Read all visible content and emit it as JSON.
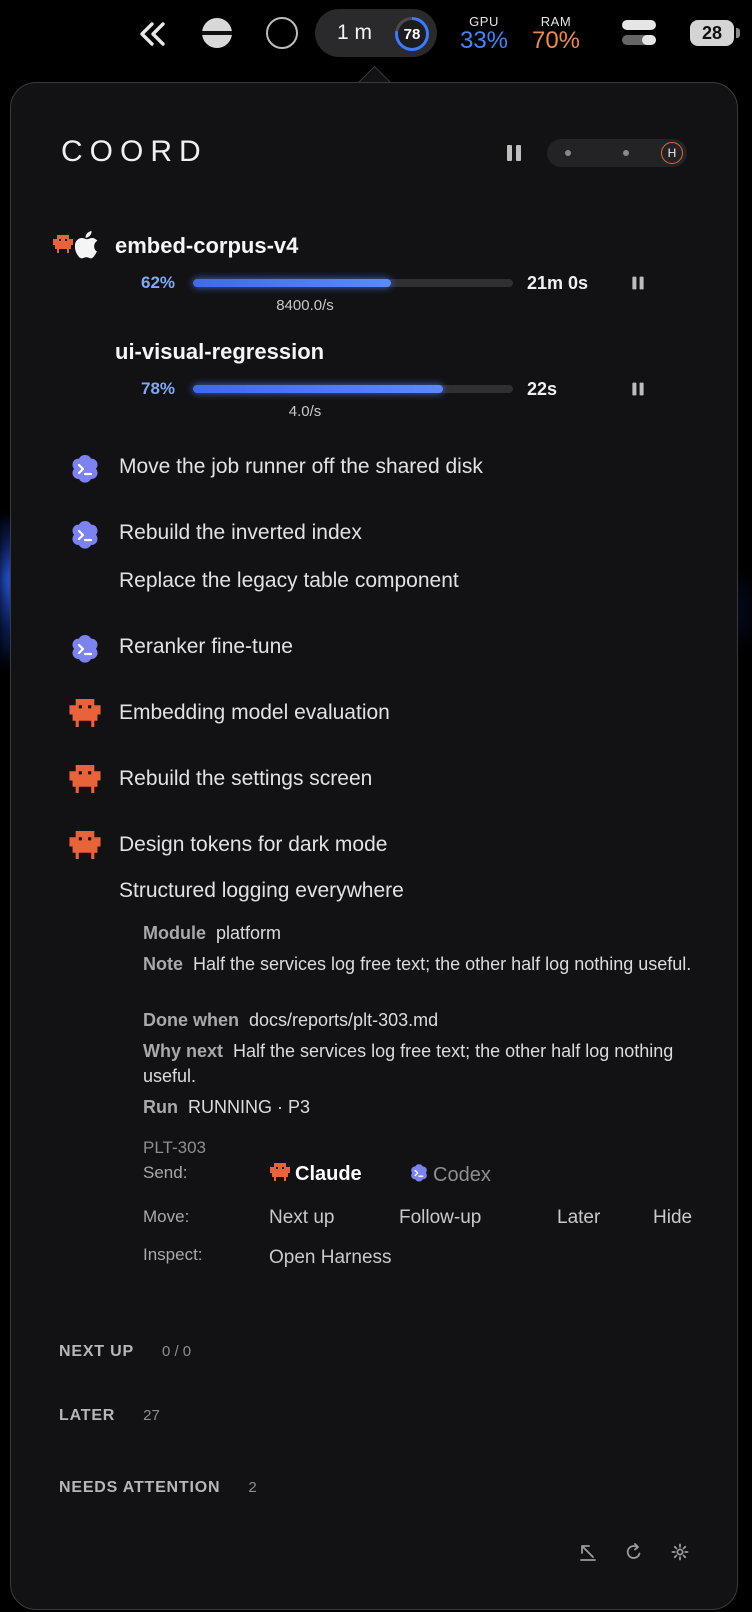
{
  "menubar": {
    "timer_label": "1 m",
    "timer_badge": "78",
    "timer_progress_percent": 78,
    "gpu": {
      "label": "GPU",
      "value": "33%"
    },
    "ram": {
      "label": "RAM",
      "value": "70%"
    },
    "battery": "28"
  },
  "panel": {
    "title": "COORD",
    "header_slider_badge": "H",
    "jobs": [
      {
        "name": "embed-corpus-v4",
        "percent_label": "62%",
        "progress": 0.62,
        "eta": "21m 0s",
        "rate": "8400.0/s"
      },
      {
        "name": "ui-visual-regression",
        "percent_label": "78%",
        "progress": 0.78,
        "eta": "22s",
        "rate": "4.0/s"
      }
    ],
    "tasks": [
      {
        "label": "Move the job runner off the shared disk",
        "agent": "codex"
      },
      {
        "label": "Rebuild the inverted index",
        "agent": "codex"
      },
      {
        "label": "Replace the legacy table component",
        "agent": "none"
      },
      {
        "label": "Reranker fine-tune",
        "agent": "codex"
      },
      {
        "label": "Embedding model evaluation",
        "agent": "claude"
      },
      {
        "label": "Rebuild the settings screen",
        "agent": "claude"
      },
      {
        "label": "Design tokens for dark mode",
        "agent": "claude"
      },
      {
        "label": "Structured logging everywhere",
        "agent": "none"
      }
    ],
    "detail": {
      "module_key": "Module",
      "module": "platform",
      "note_key": "Note",
      "note": "Half the services log free text; the other half log nothing useful.",
      "done_key": "Done when",
      "done": "docs/reports/plt-303.md",
      "why_key": "Why next",
      "why": "Half the services log free text; the other half log nothing useful.",
      "run_key": "Run",
      "run": "RUNNING · P3",
      "ticket": "PLT-303",
      "send_label": "Send:",
      "send_claude": "Claude",
      "send_codex": "Codex",
      "move_label": "Move:",
      "move_next": "Next up",
      "move_follow": "Follow-up",
      "move_later": "Later",
      "move_hide": "Hide",
      "inspect_label": "Inspect:",
      "inspect_open": "Open Harness"
    },
    "sections": [
      {
        "title": "NEXT UP",
        "count": "0 / 0"
      },
      {
        "title": "LATER",
        "count": "27"
      },
      {
        "title": "NEEDS ATTENTION",
        "count": "2"
      }
    ],
    "footer_icons": [
      "collapse-arrow-icon",
      "refresh-icon",
      "gear-icon"
    ],
    "colors": {
      "accent_blue": "#5b89ff",
      "claude_orange": "#e8623a",
      "codex_purple": "#7c83f0"
    }
  }
}
